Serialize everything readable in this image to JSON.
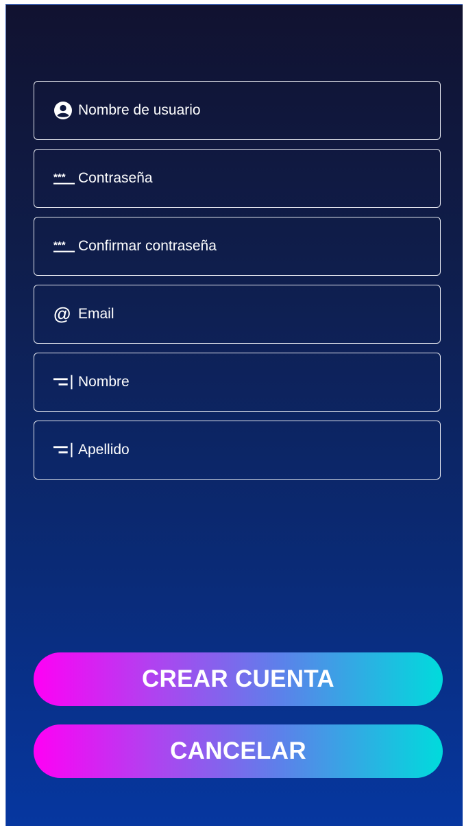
{
  "form": {
    "fields": [
      {
        "icon": "account-circle-icon",
        "label": "Nombre de usuario"
      },
      {
        "icon": "password-icon",
        "label": "Contraseña"
      },
      {
        "icon": "password-icon",
        "label": "Confirmar contraseña"
      },
      {
        "icon": "at-sign-icon",
        "label": "Email"
      },
      {
        "icon": "text-cursor-icon",
        "label": "Nombre"
      },
      {
        "icon": "text-cursor-icon",
        "label": "Apellido"
      }
    ]
  },
  "actions": {
    "create_label": "CREAR CUENTA",
    "cancel_label": "CANCELAR"
  },
  "colors": {
    "background_top": "#111230",
    "background_bottom": "#0637a0",
    "button_gradient_start": "#ff00f5",
    "button_gradient_end": "#00dbdc",
    "field_border": "#e6e8f0"
  }
}
